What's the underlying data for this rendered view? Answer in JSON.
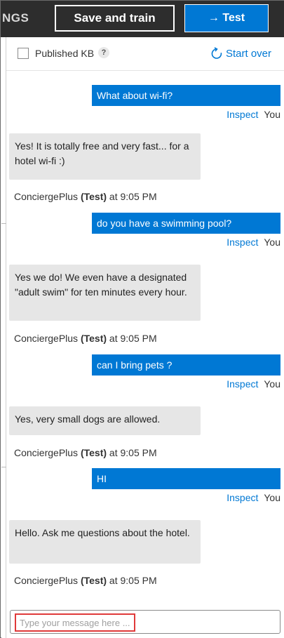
{
  "topbar": {
    "truncated_tab": "NGS",
    "save_train_label": "Save and train",
    "test_label": "Test",
    "test_icon": "arrow-right-icon"
  },
  "panel": {
    "published_kb_label": "Published KB",
    "help_glyph": "?",
    "start_over_label": "Start over"
  },
  "conversation": [
    {
      "from": "user",
      "text": "What about wi-fi?",
      "inspect": "Inspect",
      "sender": "You"
    },
    {
      "from": "bot",
      "text": "Yes! It is totally free and very fast... for a hotel wi-fi :)",
      "bot_name": "ConciergePlus",
      "tag": "(Test)",
      "time": "at 9:05 PM"
    },
    {
      "from": "user",
      "text": "do you have a swimming pool?",
      "inspect": "Inspect",
      "sender": "You"
    },
    {
      "from": "bot",
      "text": "Yes we do! We even have a designated \"adult swim\" for ten minutes every hour.",
      "bot_name": "ConciergePlus",
      "tag": "(Test)",
      "time": "at 9:05 PM"
    },
    {
      "from": "user",
      "text": "can I bring pets ?",
      "inspect": "Inspect",
      "sender": "You"
    },
    {
      "from": "bot",
      "text": "Yes, very small dogs are allowed.",
      "bot_name": "ConciergePlus",
      "tag": "(Test)",
      "time": "at 9:05 PM"
    },
    {
      "from": "user",
      "text": "HI",
      "inspect": "Inspect",
      "sender": "You"
    },
    {
      "from": "bot",
      "text": "Hello. Ask me questions about the hotel.",
      "bot_name": "ConciergePlus",
      "tag": "(Test)",
      "time": "at 9:05 PM"
    }
  ],
  "input": {
    "placeholder": "Type your message here ...",
    "value": ""
  },
  "colors": {
    "accent": "#0078d4",
    "topbar_bg": "#2d2d2d",
    "bot_bubble": "#e6e6e6",
    "highlight": "#e03a3a"
  }
}
